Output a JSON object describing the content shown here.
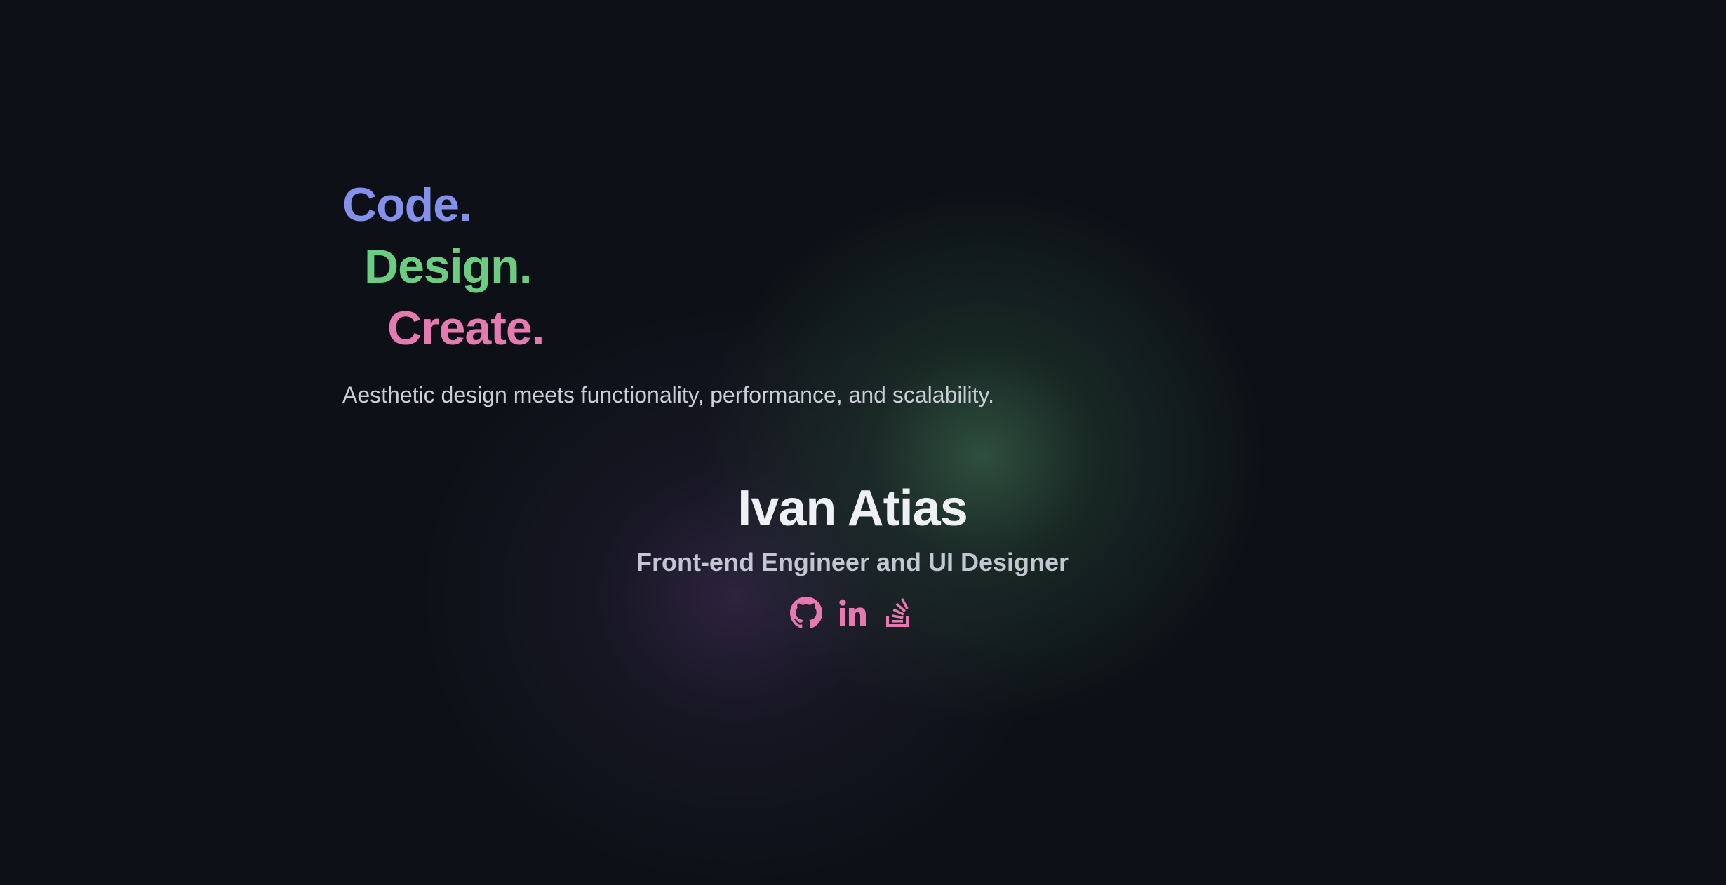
{
  "hero": {
    "tagline": [
      "Code.",
      "Design.",
      "Create."
    ],
    "subtitle": "Aesthetic design meets functionality, performance, and scalability."
  },
  "profile": {
    "name": "Ivan Atias",
    "role": "Front-end Engineer and UI Designer"
  },
  "socials": [
    {
      "icon": "github-icon"
    },
    {
      "icon": "linkedin-icon"
    },
    {
      "icon": "stackoverflow-icon"
    }
  ],
  "colors": {
    "background": "#0d1117",
    "code": "#8391ea",
    "design": "#6ccc80",
    "create": "#e57ab0",
    "icon": "#e57ab0",
    "heading": "#eef0f3",
    "muted": "#c3c7d1"
  }
}
